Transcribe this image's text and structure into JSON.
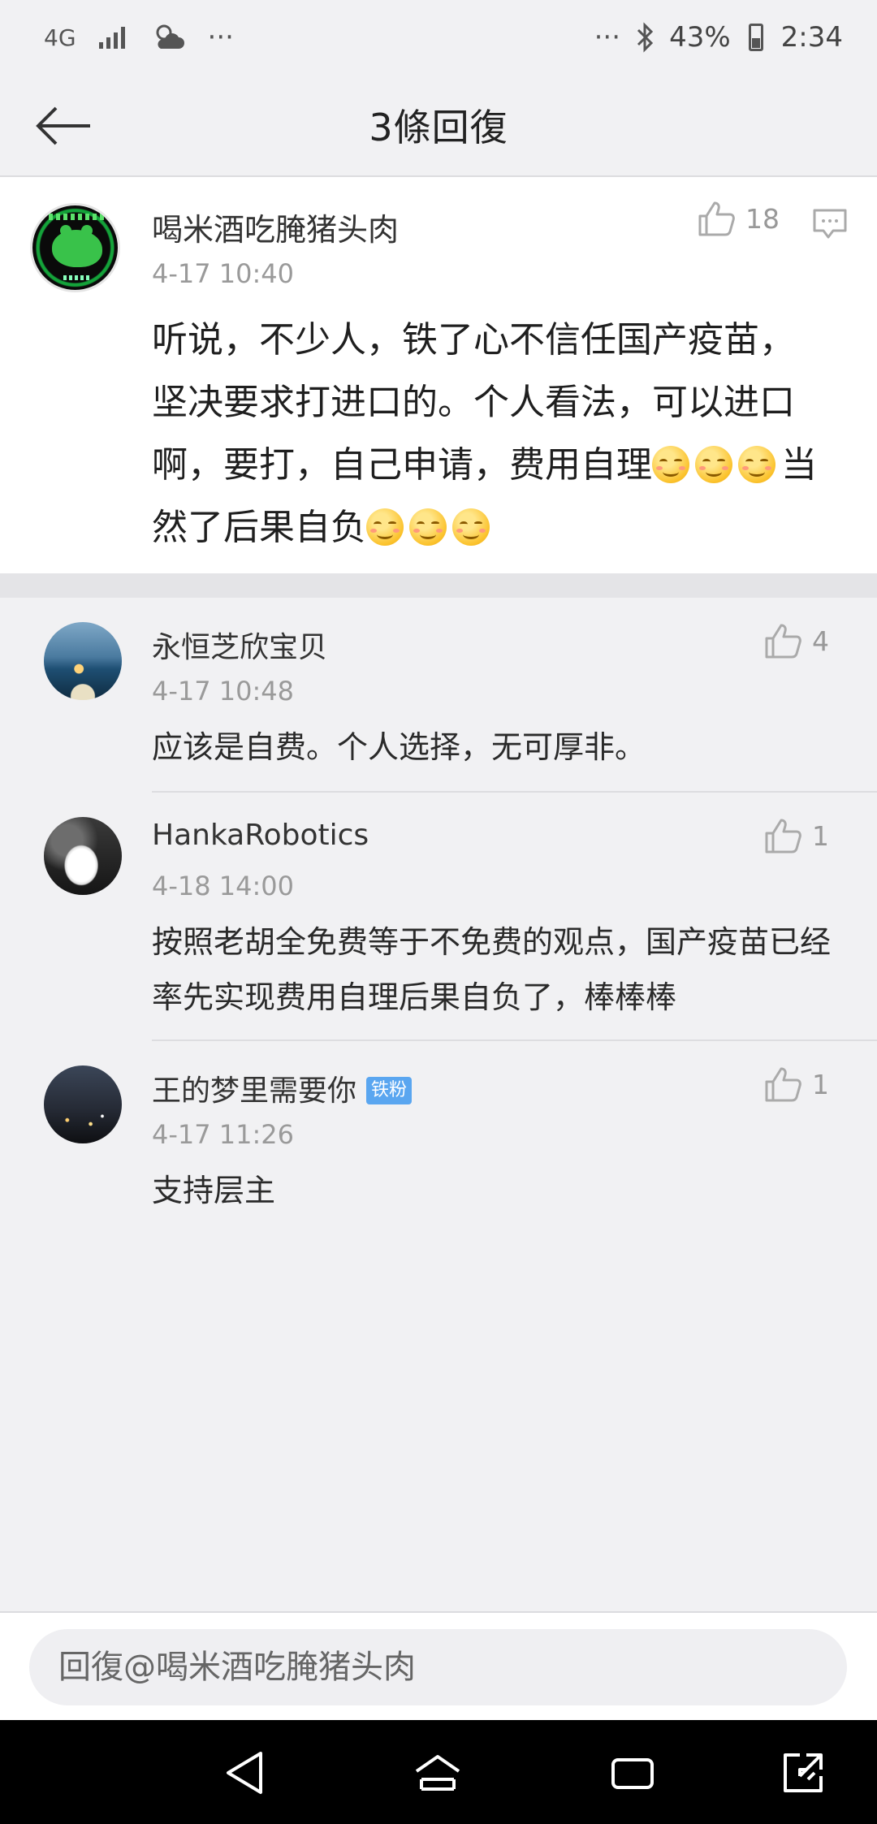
{
  "status_bar": {
    "network": "4G",
    "more": "···",
    "more_right": "···",
    "battery": "43%",
    "time": "2:34"
  },
  "header": {
    "title": "3條回復"
  },
  "main_post": {
    "username": "喝米酒吃腌猪头肉",
    "time": "4-17 10:40",
    "likes": "18",
    "text_before": "听说，不少人，铁了心不信任国产疫苗，坚决要求打进口的。个人看法，可以进口啊，要打，自己申请，费用自理",
    "text_after": "当然了后果自负",
    "emoji_before_count": 3,
    "emoji_after_count": 3
  },
  "replies": [
    {
      "username": "永恒芝欣宝贝",
      "time": "4-17 10:48",
      "likes": "4",
      "text": "应该是自费。个人选择，无可厚非。",
      "badge": ""
    },
    {
      "username": "HankaRobotics",
      "time": "4-18 14:00",
      "likes": "1",
      "text": "按照老胡全免费等于不免费的观点，国产疫苗已经率先实现费用自理后果自负了，棒棒棒",
      "badge": ""
    },
    {
      "username": "王的梦里需要你",
      "time": "4-17 11:26",
      "likes": "1",
      "text": "支持层主",
      "badge": "铁粉"
    }
  ],
  "reply_box": {
    "placeholder": "回復@喝米酒吃腌猪头肉"
  },
  "colors": {
    "background": "#f1f1f3",
    "card": "#ffffff",
    "badge": "#5aa6f0",
    "nav_bar": "#000000"
  },
  "icons": [
    "back-arrow-icon",
    "thumbs-up-icon",
    "comment-icon",
    "bluetooth-icon",
    "weather-icon",
    "signal-icon",
    "nav-back-icon",
    "nav-home-icon",
    "nav-recents-icon",
    "nav-expand-icon"
  ]
}
